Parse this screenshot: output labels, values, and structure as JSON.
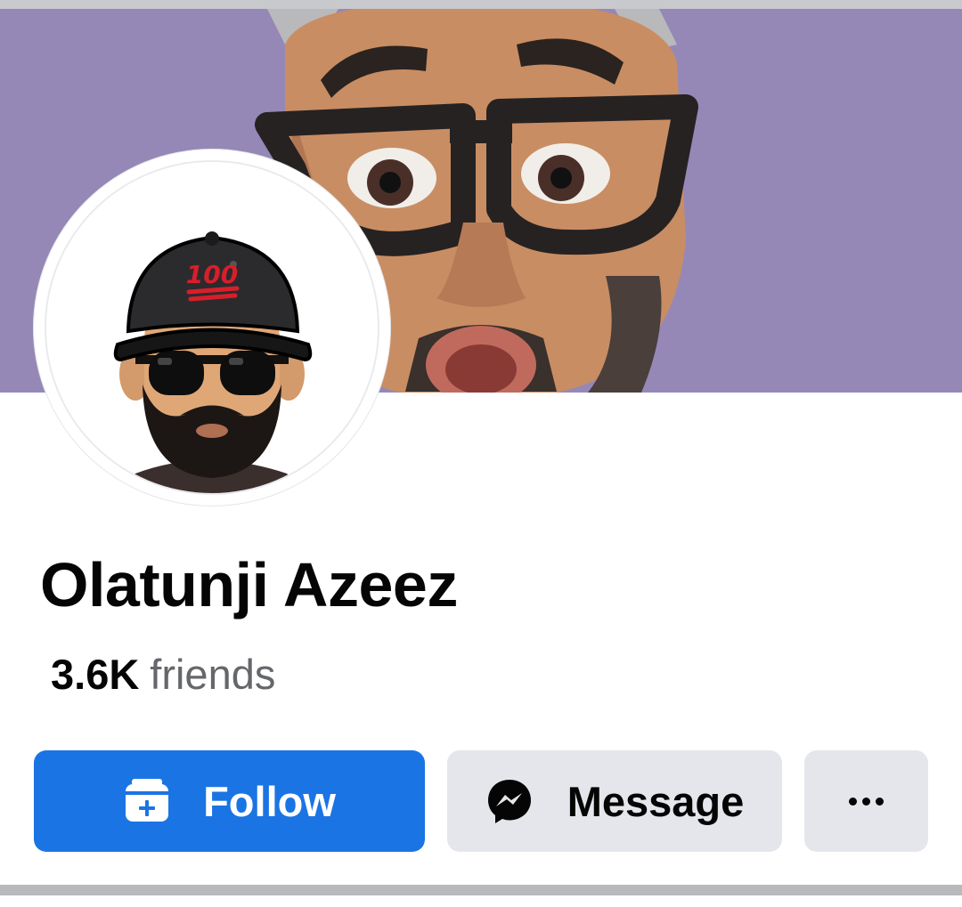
{
  "profile": {
    "name": "Olatunji Azeez",
    "friends_count": "3.6K",
    "friends_label": "friends",
    "cap_text": "100"
  },
  "actions": {
    "follow_label": "Follow",
    "message_label": "Message",
    "more_icon": "more-dots-icon",
    "follow_icon": "follow-inbox-plus-icon",
    "message_icon": "messenger-icon"
  },
  "colors": {
    "cover_bg": "#9588b7",
    "primary": "#1b74e4",
    "secondary_button": "#e4e6eb",
    "text_primary": "#050505",
    "text_secondary": "#65676b"
  }
}
